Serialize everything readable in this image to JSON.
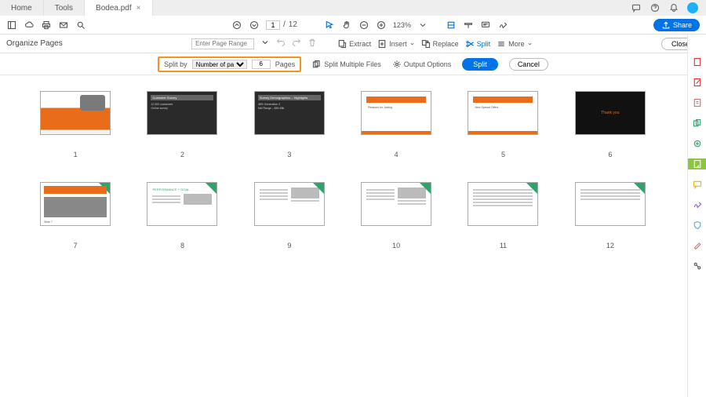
{
  "tabs": {
    "home": "Home",
    "tools": "Tools",
    "file": "Bodea.pdf"
  },
  "toolbar": {
    "page_current": "1",
    "page_sep": "/",
    "page_total": "12",
    "zoom": "123%",
    "share": "Share"
  },
  "orgbar": {
    "title": "Organize Pages",
    "page_range_placeholder": "Enter Page Range",
    "extract": "Extract",
    "insert": "Insert",
    "replace": "Replace",
    "split": "Split",
    "more": "More",
    "close": "Close"
  },
  "splitbar": {
    "splitby_label": "Split by",
    "splitby_option": "Number of pages",
    "value": "6",
    "unit": "Pages",
    "multiple": "Split Multiple Files",
    "output": "Output Options",
    "split": "Split",
    "cancel": "Cancel"
  },
  "thumbs": {
    "nums": [
      "1",
      "2",
      "3",
      "4",
      "5",
      "6",
      "7",
      "8",
      "9",
      "10",
      "11",
      "12"
    ]
  },
  "preview": {
    "p2_title": "Customer Survey",
    "p2_l1": "12,500 customers",
    "p2_l2": "Online survey",
    "p3_title": "Survey Demographics – Highlights",
    "p3_l1": "48% Generation Z",
    "p3_l2": "Mid Range – $50-65k",
    "p4_title": "Reasons for Joining",
    "p5_title": "New Special Offers",
    "p6_text": "Thank you",
    "p8_title": "PERFORMANCE + GOAL"
  }
}
